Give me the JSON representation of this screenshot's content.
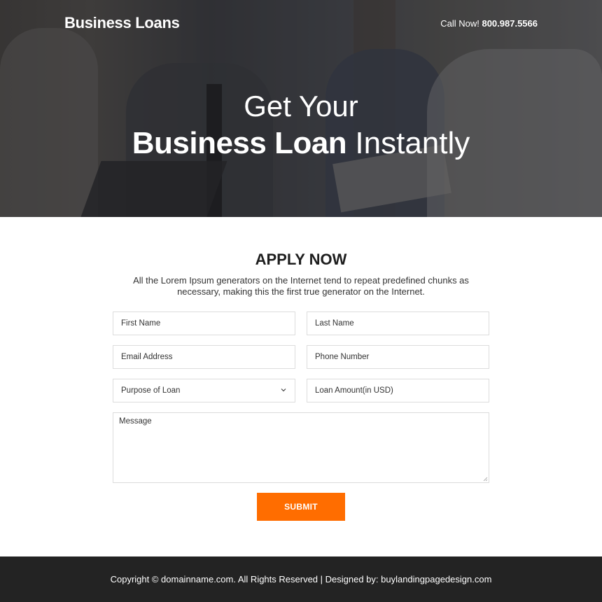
{
  "header": {
    "logo": "Business Loans",
    "call_label": "Call Now!",
    "phone": "800.987.5566"
  },
  "hero": {
    "line1": "Get Your",
    "line2_bold": "Business Loan",
    "line2_rest": " Instantly"
  },
  "apply": {
    "title": "APPLY NOW",
    "description": "All the Lorem Ipsum generators on the Internet tend to repeat predefined chunks as necessary, making this the first true generator on the Internet.",
    "fields": {
      "first_name": "First Name",
      "last_name": "Last Name",
      "email": "Email Address",
      "phone": "Phone Number",
      "purpose": "Purpose of Loan",
      "amount": "Loan Amount(in USD)",
      "message": "Message"
    },
    "submit_label": "SUBMIT"
  },
  "footer": {
    "text": "Copyright © domainname.com. All Rights Reserved | Designed by: buylandingpagedesign.com"
  },
  "colors": {
    "accent": "#ff6d00",
    "footer_bg": "#232323"
  }
}
